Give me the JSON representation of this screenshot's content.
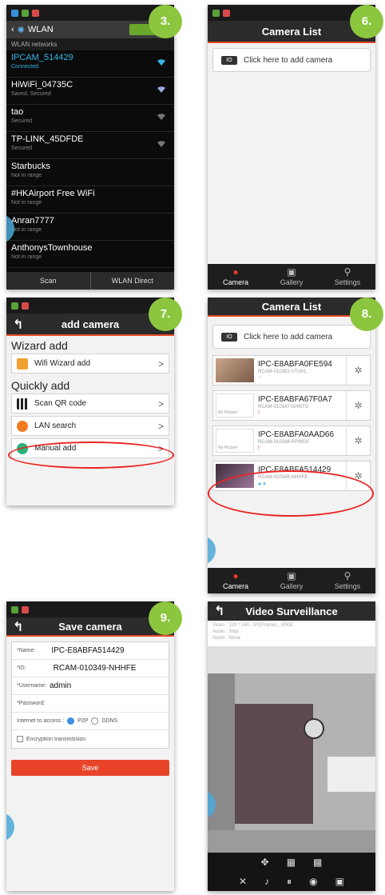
{
  "badges": {
    "b3": "3.",
    "b6": "6.",
    "b7": "7.",
    "b8": "8.",
    "b9": "9."
  },
  "wlan": {
    "title": "WLAN",
    "toggle": "I",
    "subheader": "WLAN networks",
    "networks": [
      {
        "name": "IPCAM_514429",
        "status": "Connected"
      },
      {
        "name": "HiWiFi_04735C",
        "status": "Saved, Secured"
      },
      {
        "name": "tao",
        "status": "Secured"
      },
      {
        "name": "TP-LINK_45DFDE",
        "status": "Secured"
      },
      {
        "name": "Starbucks",
        "status": "Not in range"
      },
      {
        "name": "#HKAirport Free WiFi",
        "status": "Not in range"
      },
      {
        "name": "Anran7777",
        "status": "Not in range"
      },
      {
        "name": "AnthonysTownhouse",
        "status": "Not in range"
      }
    ],
    "footer": {
      "scan": "Scan",
      "direct": "WLAN Direct"
    }
  },
  "camera_list": {
    "title": "Camera List",
    "add_label": "Click here to add camera",
    "cam_icon_text": "IO",
    "tabs": [
      "Camera",
      "Gallery",
      "Settings"
    ]
  },
  "add_camera": {
    "title": "add camera",
    "wizard_header": "Wizard add",
    "quick_header": "Quickly add",
    "items": {
      "wifi_wizard": "Wifi Wizard add",
      "scan_qr": "Scan QR code",
      "lan_search": "LAN search",
      "manual": "Manual add"
    }
  },
  "cam_list2": {
    "title": "Camera List",
    "add_label": "Click here to add camera",
    "cameras": [
      {
        "name": "IPC-E8ABFA0FE594",
        "id": "RCAM-010352-VTUVL"
      },
      {
        "name": "IPC-E8ABFA67F0A7",
        "id": "RCAM-010347-GHNTG",
        "thumb_text": "No Picture!"
      },
      {
        "name": "IPC-E8ABFA0AAD66",
        "id": "RCAM-010348-PPWOV",
        "thumb_text": "No Picture!"
      },
      {
        "name": "IPC-E8ABFA514429",
        "id": "RCAM-010349-NHHFE"
      }
    ],
    "tabs": [
      "Camera",
      "Gallery",
      "Settings"
    ]
  },
  "save_camera": {
    "title": "Save camera",
    "name_label": "*Name:",
    "name_value": "IPC-E8ABFA514429",
    "id_label": "*ID:",
    "id_value": "RCAM-010349-NHHFE",
    "user_label": "*Username:",
    "user_value": "admin",
    "pass_label": "*Password:",
    "access_label": "Internet to access :",
    "p2p": "P2P",
    "ddns": "DDNS",
    "encryption": "Encryption transmission",
    "save": "Save"
  },
  "video": {
    "title": "Video Surveillance",
    "line1": "Video : 320 * 240 , 0/0(Frame) , 00KB",
    "line2": "Audio : Stop",
    "line3": "Alarm : None"
  },
  "colors": {
    "accent": "#e64a2a",
    "badge": "#8cc63f",
    "wifi_connected": "#33b5e5"
  }
}
